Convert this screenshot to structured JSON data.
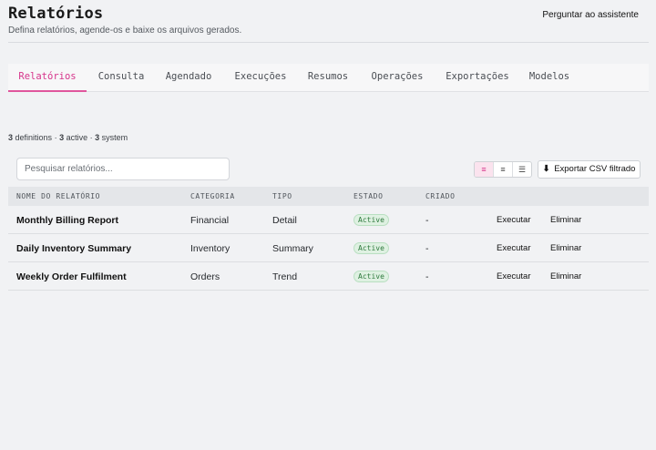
{
  "header": {
    "title": "Relatórios",
    "subtitle": "Defina relatórios, agende-os e baixe os arquivos gerados.",
    "assistant_label": "Perguntar ao assistente"
  },
  "tabs": [
    {
      "label": "Relatórios",
      "active": true
    },
    {
      "label": "Consulta",
      "active": false
    },
    {
      "label": "Agendado",
      "active": false
    },
    {
      "label": "Execuções",
      "active": false
    },
    {
      "label": "Resumos",
      "active": false
    },
    {
      "label": "Operações",
      "active": false
    },
    {
      "label": "Exportações",
      "active": false
    },
    {
      "label": "Modelos",
      "active": false
    }
  ],
  "summary": {
    "definitions_count": "3",
    "definitions_label": "definitions",
    "active_count": "3",
    "active_label": "active",
    "system_count": "3",
    "system_label": "system"
  },
  "search": {
    "placeholder": "Pesquisar relatórios..."
  },
  "view_toggle": [
    {
      "icon": "list-icon",
      "glyph": "≡",
      "active": true
    },
    {
      "icon": "compact-list-icon",
      "glyph": "≡",
      "active": false
    },
    {
      "icon": "detail-list-icon",
      "glyph": "☰",
      "active": false
    }
  ],
  "export": {
    "icon": "download-icon",
    "glyph": "⬇",
    "label": "Exportar CSV filtrado"
  },
  "table": {
    "columns": [
      "NOME DO RELATÓRIO",
      "CATEGORIA",
      "TIPO",
      "ESTADO",
      "CRIADO"
    ],
    "rows": [
      {
        "name": "Monthly Billing Report",
        "category": "Financial",
        "type": "Detail",
        "status": "Active",
        "created": "-",
        "run_label": "Executar",
        "delete_label": "Eliminar"
      },
      {
        "name": "Daily Inventory Summary",
        "category": "Inventory",
        "type": "Summary",
        "status": "Active",
        "created": "-",
        "run_label": "Executar",
        "delete_label": "Eliminar"
      },
      {
        "name": "Weekly Order Fulfilment",
        "category": "Orders",
        "type": "Trend",
        "status": "Active",
        "created": "-",
        "run_label": "Executar",
        "delete_label": "Eliminar"
      }
    ]
  },
  "colors": {
    "accent": "#d6338a",
    "active_badge_bg": "#dff1e2",
    "active_badge_text": "#2f7a3e"
  }
}
